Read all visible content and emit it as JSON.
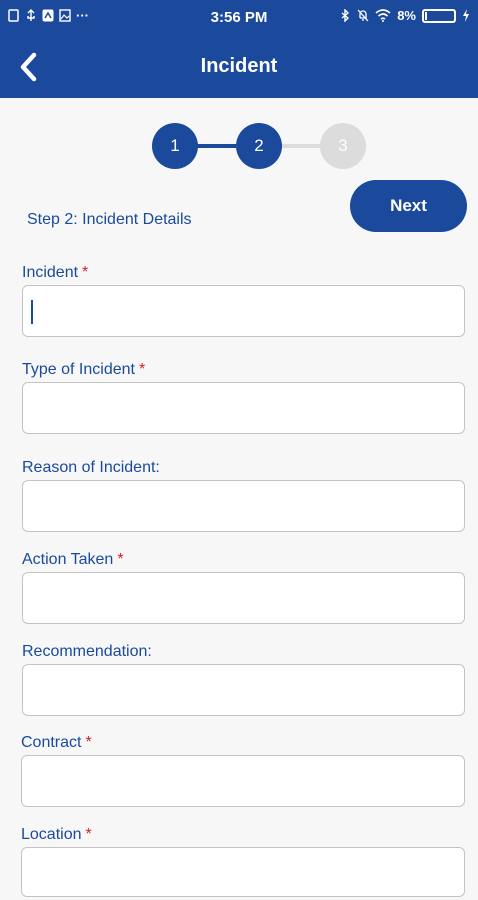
{
  "status_bar": {
    "time": "3:56 PM",
    "battery_percent": "8%",
    "battery_level": 0.08
  },
  "header": {
    "title": "Incident",
    "back_icon": "chevron-left-icon"
  },
  "stepper": {
    "steps": [
      "1",
      "2",
      "3"
    ],
    "current_step": 2
  },
  "step_label": "Step 2: Incident Details",
  "next_label": "Next",
  "fields": [
    {
      "label": "Incident",
      "required": "*",
      "value": ""
    },
    {
      "label": "Type of Incident",
      "required": "*",
      "value": ""
    },
    {
      "label": "Reason of Incident:",
      "required": "",
      "value": ""
    },
    {
      "label": "Action Taken",
      "required": "*",
      "value": ""
    },
    {
      "label": "Recommendation:",
      "required": "",
      "value": ""
    },
    {
      "label": "Contract",
      "required": "*",
      "value": ""
    },
    {
      "label": "Location",
      "required": "*",
      "value": ""
    }
  ],
  "colors": {
    "primary": "#1b4a9c",
    "required": "#d32020",
    "inactive_step": "#dcdcdc"
  }
}
